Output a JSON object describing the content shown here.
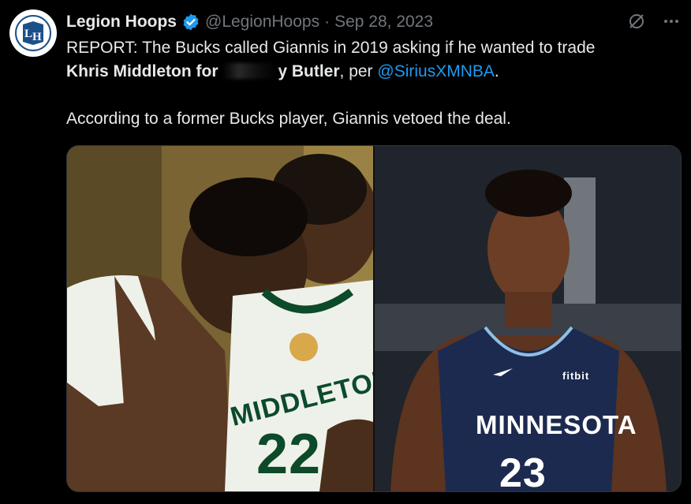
{
  "tweet": {
    "author_name": "Legion Hoops",
    "handle": "@LegionHoops",
    "separator": "·",
    "date": "Sep 28, 2023",
    "line1": "REPORT: The Bucks called Giannis in 2019 asking if he wanted to trade",
    "line2_bold_a": "Khris Middleton for",
    "line2_bold_b": "y Butler",
    "line2_rest": ", per ",
    "mention": "@SiriusXMNBA",
    "line2_end": ".",
    "line3": "According to a former Bucks player, Giannis vetoed the deal."
  },
  "media": {
    "left_jersey_name": "MIDDLETON",
    "left_jersey_number": "22",
    "right_team": "MINNESOTA",
    "right_number": "23",
    "right_sponsor": "fitbit"
  },
  "icons": [
    "verified-icon",
    "grok-icon",
    "more-icon"
  ],
  "colors": {
    "background": "#000000",
    "link": "#1d9bf0",
    "muted": "#71767b",
    "verified": "#1d9bf0"
  }
}
